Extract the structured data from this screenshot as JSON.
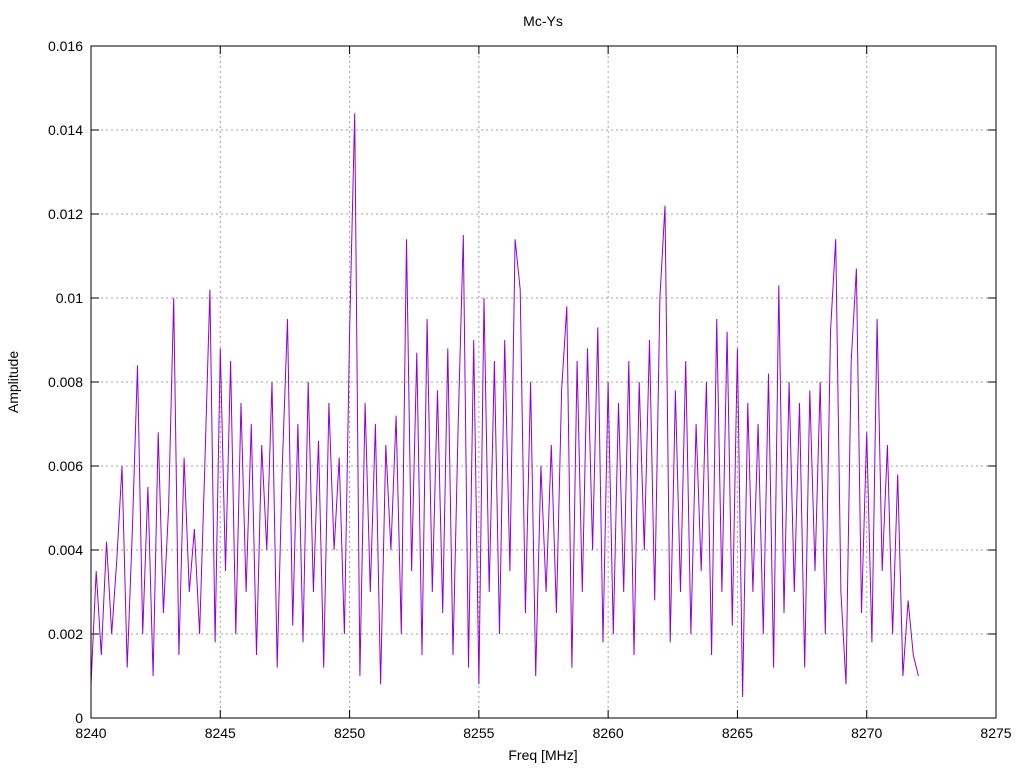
{
  "chart_data": {
    "type": "line",
    "title": "Mc-Ys",
    "xlabel": "Freq [MHz]",
    "ylabel": "Amplitude",
    "xlim": [
      8240,
      8275
    ],
    "ylim": [
      0,
      0.016
    ],
    "xticks": [
      "8240",
      "8245",
      "8250",
      "8255",
      "8260",
      "8265",
      "8270",
      "8275"
    ],
    "yticks": [
      "0",
      "0.002",
      "0.004",
      "0.006",
      "0.008",
      "0.01",
      "0.012",
      "0.014",
      "0.016"
    ],
    "grid": true,
    "series": [
      {
        "name": "Mc-Ys",
        "color": "#9400d3",
        "x_start": 8240,
        "x_step": 0.2,
        "values": [
          0.0008,
          0.0035,
          0.0015,
          0.0042,
          0.002,
          0.0038,
          0.006,
          0.0012,
          0.0045,
          0.0084,
          0.002,
          0.0055,
          0.001,
          0.0068,
          0.0025,
          0.005,
          0.01,
          0.0015,
          0.0062,
          0.003,
          0.0045,
          0.002,
          0.006,
          0.0102,
          0.0018,
          0.0088,
          0.0035,
          0.0085,
          0.002,
          0.0075,
          0.003,
          0.007,
          0.0015,
          0.0065,
          0.004,
          0.008,
          0.0012,
          0.006,
          0.0095,
          0.0022,
          0.007,
          0.0018,
          0.008,
          0.003,
          0.0066,
          0.0012,
          0.0075,
          0.004,
          0.0062,
          0.002,
          0.0092,
          0.0144,
          0.001,
          0.0075,
          0.003,
          0.007,
          0.0008,
          0.0065,
          0.004,
          0.0072,
          0.002,
          0.0114,
          0.0035,
          0.0087,
          0.0015,
          0.0095,
          0.003,
          0.0078,
          0.0025,
          0.0088,
          0.0015,
          0.007,
          0.0115,
          0.0012,
          0.009,
          0.0008,
          0.01,
          0.003,
          0.0085,
          0.002,
          0.009,
          0.0035,
          0.0114,
          0.0102,
          0.0025,
          0.008,
          0.001,
          0.006,
          0.003,
          0.0065,
          0.0025,
          0.0078,
          0.0098,
          0.0012,
          0.0085,
          0.003,
          0.0088,
          0.004,
          0.0093,
          0.0018,
          0.008,
          0.002,
          0.0075,
          0.003,
          0.0085,
          0.0015,
          0.008,
          0.004,
          0.009,
          0.0028,
          0.01,
          0.0122,
          0.0018,
          0.0078,
          0.003,
          0.0085,
          0.002,
          0.007,
          0.0035,
          0.008,
          0.0015,
          0.0095,
          0.003,
          0.0092,
          0.0022,
          0.0088,
          0.0005,
          0.0075,
          0.003,
          0.007,
          0.002,
          0.0082,
          0.0012,
          0.0103,
          0.0025,
          0.008,
          0.003,
          0.0075,
          0.0012,
          0.0078,
          0.0035,
          0.008,
          0.002,
          0.0092,
          0.0114,
          0.003,
          0.0008,
          0.0085,
          0.0107,
          0.0025,
          0.0068,
          0.0018,
          0.0095,
          0.0035,
          0.0065,
          0.002,
          0.0058,
          0.001,
          0.0028,
          0.0015,
          0.001
        ]
      }
    ]
  }
}
